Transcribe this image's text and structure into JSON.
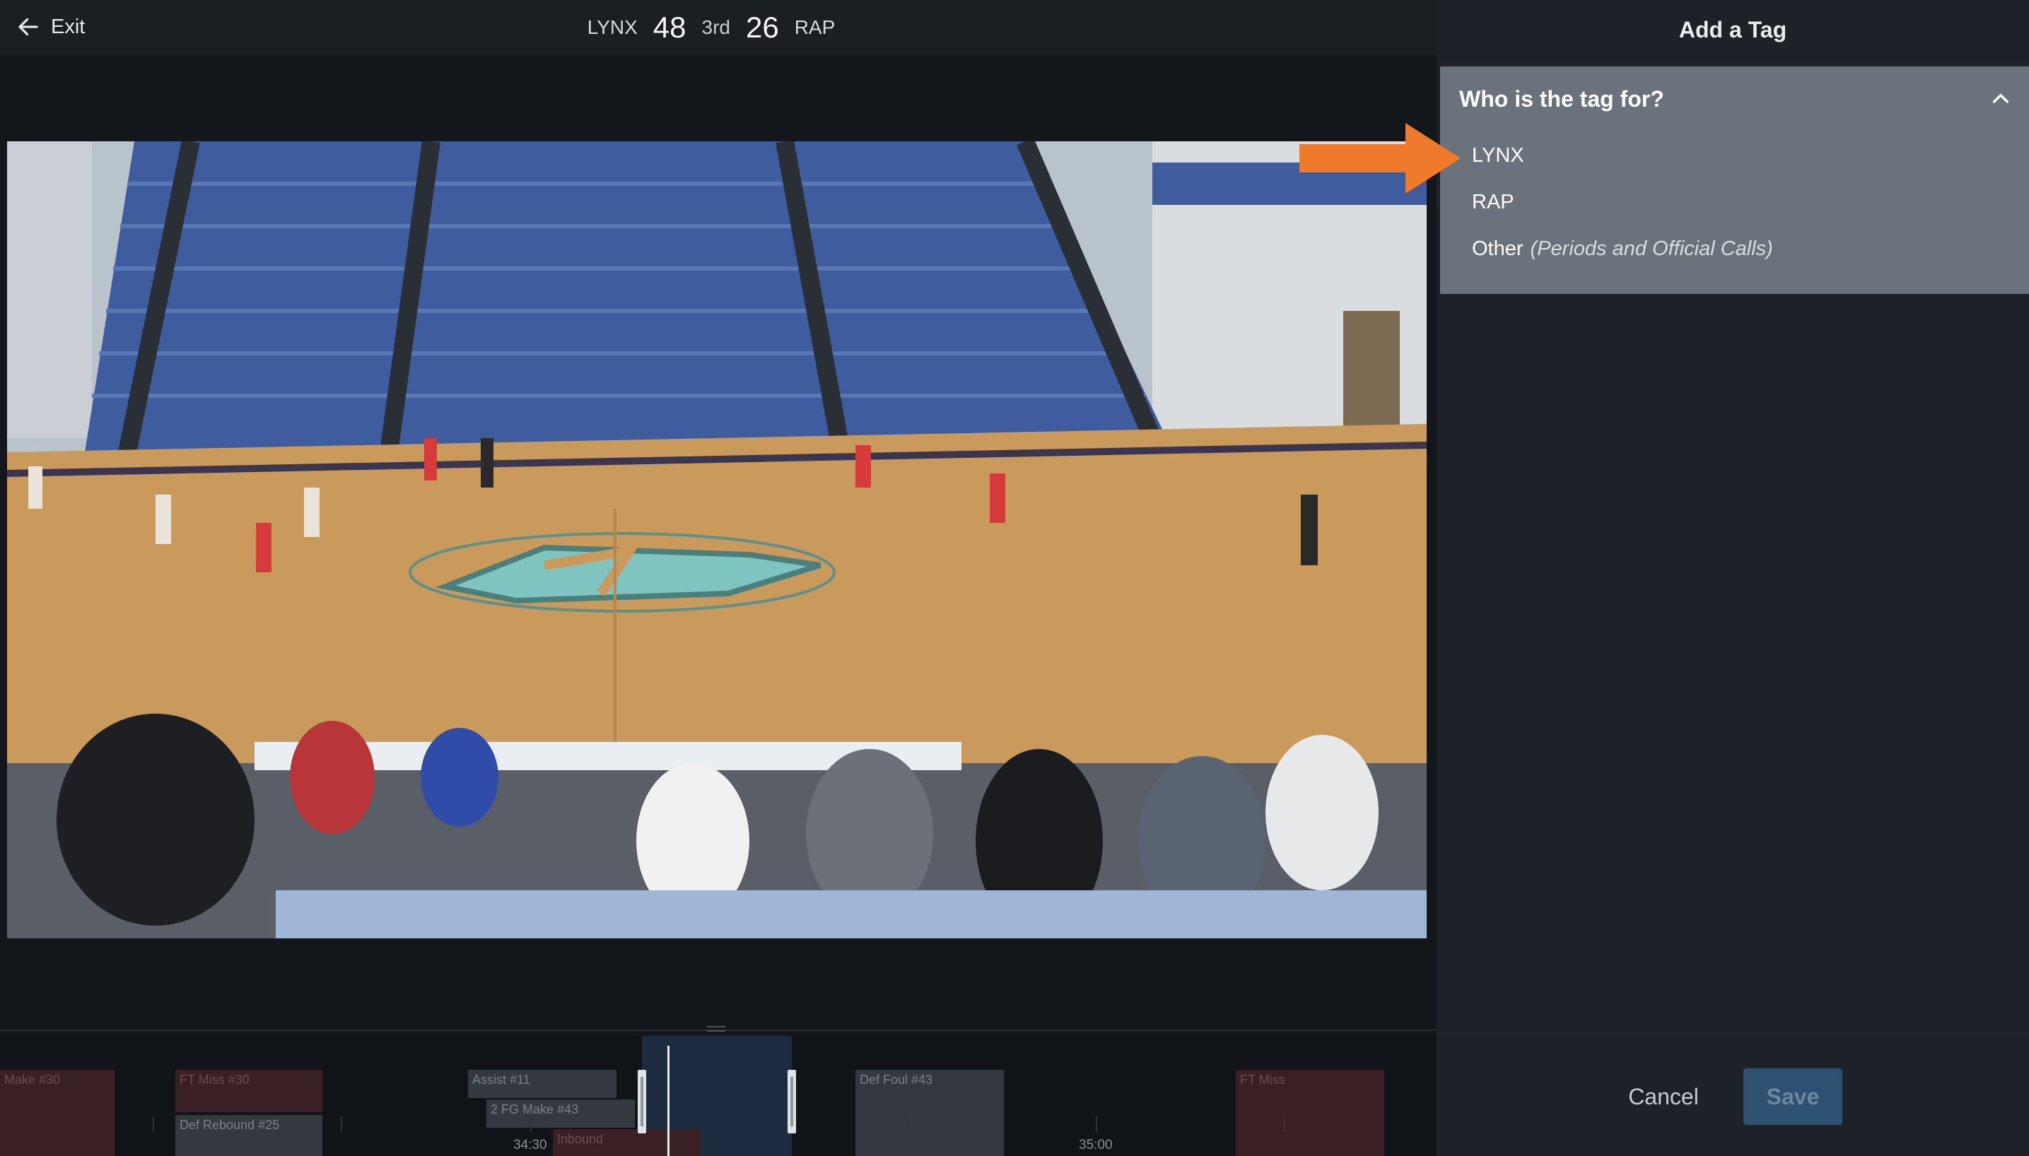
{
  "topbar": {
    "exit_label": "Exit",
    "home_team": "LYNX",
    "home_score": "48",
    "period": "3rd",
    "away_score": "26",
    "away_team": "RAP"
  },
  "panel": {
    "title": "Add a Tag",
    "question": "Who is the tag for?",
    "options": [
      {
        "label": "LYNX"
      },
      {
        "label": "RAP"
      },
      {
        "label": "Other",
        "hint": "(Periods and Official Calls)"
      }
    ],
    "cancel_label": "Cancel",
    "save_label": "Save"
  },
  "timeline": {
    "clips": [
      {
        "label": "Make #30"
      },
      {
        "label": "FT Miss #30"
      },
      {
        "label": "Def Rebound #25"
      },
      {
        "label": "Assist #11"
      },
      {
        "label": "2 FG Make #43"
      },
      {
        "label": "Inbound"
      },
      {
        "label": "Def Foul #43"
      },
      {
        "label": "FT Miss"
      }
    ],
    "times": [
      "34:30",
      "35:00"
    ]
  },
  "colors": {
    "accent_orange": "#ef7a2c",
    "panel_section_bg": "#6a737c",
    "save_bg": "#2e5071"
  }
}
